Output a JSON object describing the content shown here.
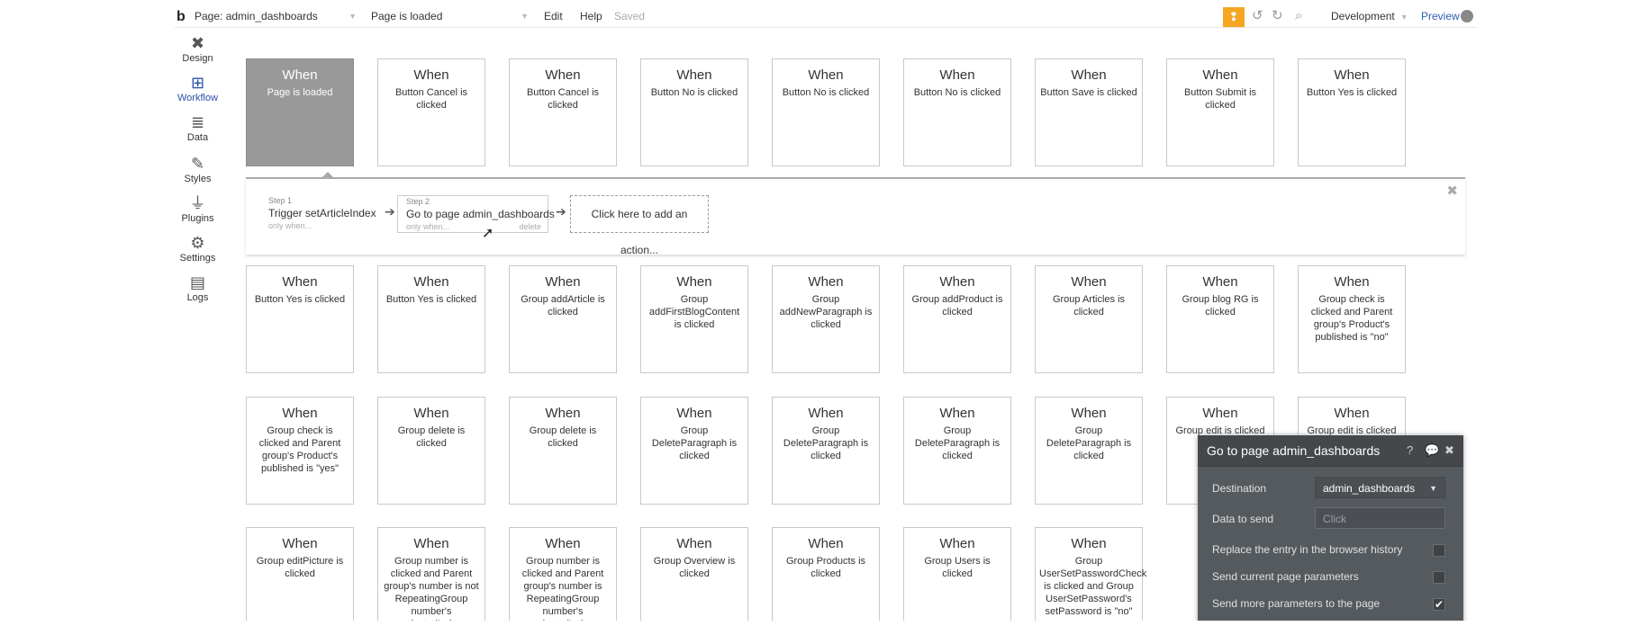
{
  "topbar": {
    "logo": "b",
    "page_label": "Page: admin_dashboards",
    "state_label": "Page is loaded",
    "menu_edit": "Edit",
    "menu_help": "Help",
    "saved": "Saved",
    "warning_icon": "gift-warning-icon",
    "environment": "Development",
    "preview": "Preview"
  },
  "sidebar": {
    "items": [
      {
        "label": "Design",
        "icon": "design-icon"
      },
      {
        "label": "Workflow",
        "icon": "workflow-icon"
      },
      {
        "label": "Data",
        "icon": "database-icon"
      },
      {
        "label": "Styles",
        "icon": "brush-icon"
      },
      {
        "label": "Plugins",
        "icon": "plug-icon"
      },
      {
        "label": "Settings",
        "icon": "gear-icon"
      },
      {
        "label": "Logs",
        "icon": "document-icon"
      }
    ]
  },
  "when_label": "When",
  "events_row1": [
    "Page is loaded",
    "Button Cancel is clicked",
    "Button Cancel is clicked",
    "Button No is clicked",
    "Button No is clicked",
    "Button No is clicked",
    "Button Save is clicked",
    "Button Submit is clicked",
    "Button Yes is clicked"
  ],
  "events_row2": [
    "Button Yes is clicked",
    "Button Yes is clicked",
    "Group addArticle is clicked",
    "Group addFirstBlogContent is clicked",
    "Group addNewParagraph is clicked",
    "Group addProduct is clicked",
    "Group Articles is clicked",
    "Group blog RG is clicked",
    "Group check is clicked and Parent group's Product's published is \"no\""
  ],
  "events_row3": [
    "Group check is clicked and Parent group's Product's published is \"yes\"",
    "Group delete is clicked",
    "Group delete is clicked",
    "Group DeleteParagraph is clicked",
    "Group DeleteParagraph is clicked",
    "Group DeleteParagraph is clicked",
    "Group DeleteParagraph is clicked",
    "Group edit is clicked",
    "Group edit is clicked"
  ],
  "events_row4": [
    "Group editPicture is clicked",
    "Group number is clicked and Parent group's number is not RepeatingGroup number's selectedIndex",
    "Group number is clicked and Parent group's number is RepeatingGroup number's selectedIndex",
    "Group Overview is clicked",
    "Group Products is clicked",
    "Group Users is clicked",
    "Group UserSetPasswordCheck is clicked and Group UserSetPassword's setPassword is \"no\""
  ],
  "steps": {
    "step1_num": "Step 1",
    "step1_name": "Trigger setArticleIndex",
    "step1_only": "only when...",
    "step2_num": "Step 2",
    "step2_name": "Go to page admin_dashboards",
    "step2_only": "only when...",
    "step2_delete": "delete",
    "add_action": "Click here to add an action..."
  },
  "panel": {
    "title": "Go to page admin_dashboards",
    "destination_label": "Destination",
    "destination_value": "admin_dashboards",
    "data_label": "Data to send",
    "data_placeholder": "Click",
    "replace_label": "Replace the entry in the browser history",
    "send_current_label": "Send current page parameters",
    "send_more_label": "Send more parameters to the page",
    "replace_checked": false,
    "send_current_checked": false,
    "send_more_checked": true
  }
}
